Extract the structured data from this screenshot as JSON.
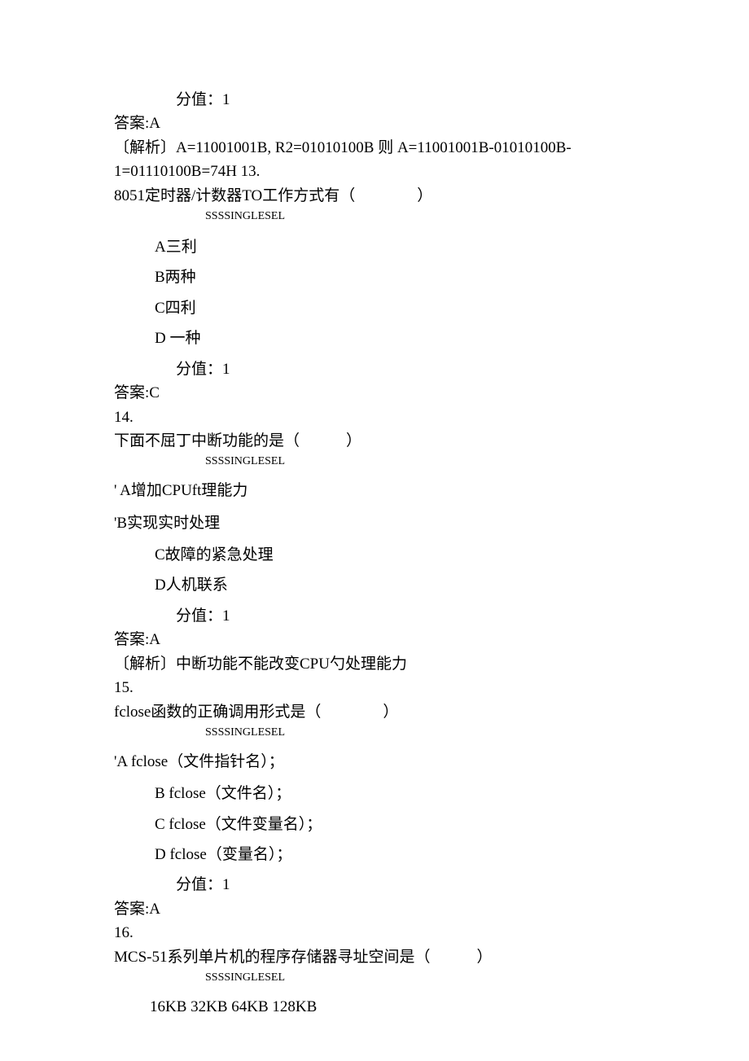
{
  "q12": {
    "score_label": "分值：1",
    "answer": "答案:A",
    "explain": "〔解析〕A=11001001B, R2=01010100B 则  A=11001001B-01010100B-1=01110100B=74H 13."
  },
  "q13": {
    "question": "8051定时器/计数器TO工作方式有（　　　　）",
    "ssss": "SSSSINGLESEL",
    "optA": "A三利",
    "optB": "B两种",
    "optC": "C四利",
    "optD": "D 一种",
    "score_label": "分值：1",
    "answer": "答案:C"
  },
  "q14": {
    "num": "14.",
    "question": "下面不屈丁中断功能的是（　　　）",
    "ssss": "SSSSINGLESEL",
    "optA": "' A增加CPUft理能力",
    "optB": "'B实现实时处理",
    "optC": "C故障的紧急处理",
    "optD": "D人机联系",
    "score_label": "分值：1",
    "answer": "答案:A",
    "explain": "〔解析〕中断功能不能改变CPU勺处理能力"
  },
  "q15": {
    "num": "15.",
    "question": "fclose函数的正确调用形式是（　　　　）",
    "ssss": "SSSSINGLESEL",
    "optA": "'A fclose（文件指针名）；",
    "optB": "B fclose（文件名）；",
    "optC": "C fclose（文件变量名）；",
    "optD": "D fclose（变量名）；",
    "score_label": "分值：1",
    "answer": "答案:A"
  },
  "q16": {
    "num": "16.",
    "question": "MCS-51系列单片机的程序存储器寻址空间是（　　　）",
    "ssss": "SSSSINGLESEL",
    "options_inline": "16KB 32KB 64KB 128KB"
  }
}
